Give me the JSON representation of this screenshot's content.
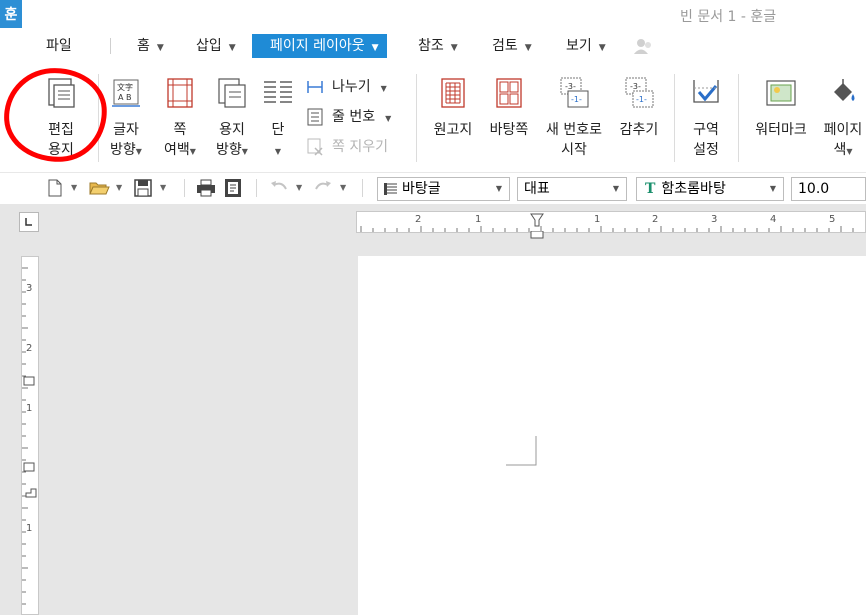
{
  "app": {
    "icon_glyph": "훈",
    "window_title": "빈 문서 1 - 훈글",
    "accent_color": "#1f8bd6"
  },
  "menubar": {
    "items": [
      {
        "label": "파일"
      },
      {
        "label": "홈"
      },
      {
        "label": "삽입"
      },
      {
        "label": "페이지 레이아웃",
        "active": true
      },
      {
        "label": "참조"
      },
      {
        "label": "검토"
      },
      {
        "label": "보기"
      }
    ]
  },
  "ribbon": {
    "edit_paper": {
      "line1": "편집",
      "line2": "용지"
    },
    "text_direction": {
      "line1": "글자",
      "line2": "방향"
    },
    "page_margin": {
      "line1": "쪽",
      "line2": "여백"
    },
    "paper_orientation": {
      "line1": "용지",
      "line2": "방향"
    },
    "columns": {
      "line1": "단"
    },
    "divide": {
      "label": "나누기"
    },
    "line_number": {
      "label": "줄 번호"
    },
    "delete_page": {
      "label": "쪽 지우기"
    },
    "manuscript": {
      "label": "원고지"
    },
    "background_page": {
      "label": "바탕쪽"
    },
    "new_number_start": {
      "line1": "새 번호로",
      "line2": "시작"
    },
    "hide": {
      "label": "감추기"
    },
    "section_settings": {
      "line1": "구역",
      "line2": "설정"
    },
    "watermark": {
      "label": "워터마크"
    },
    "page_color": {
      "line1": "페이지",
      "line2": "색"
    },
    "highlight_color": "#ff0000"
  },
  "toolbar": {
    "style_value": "바탕글",
    "lang_value": "대표",
    "font_value": "함초롬바탕",
    "font_icon": "T",
    "size_value": "10.0"
  },
  "ruler": {
    "h_labels": [
      "2",
      "1",
      "1",
      "2",
      "3",
      "4",
      "5"
    ],
    "v_labels": [
      "3",
      "2",
      "1",
      "1"
    ]
  }
}
